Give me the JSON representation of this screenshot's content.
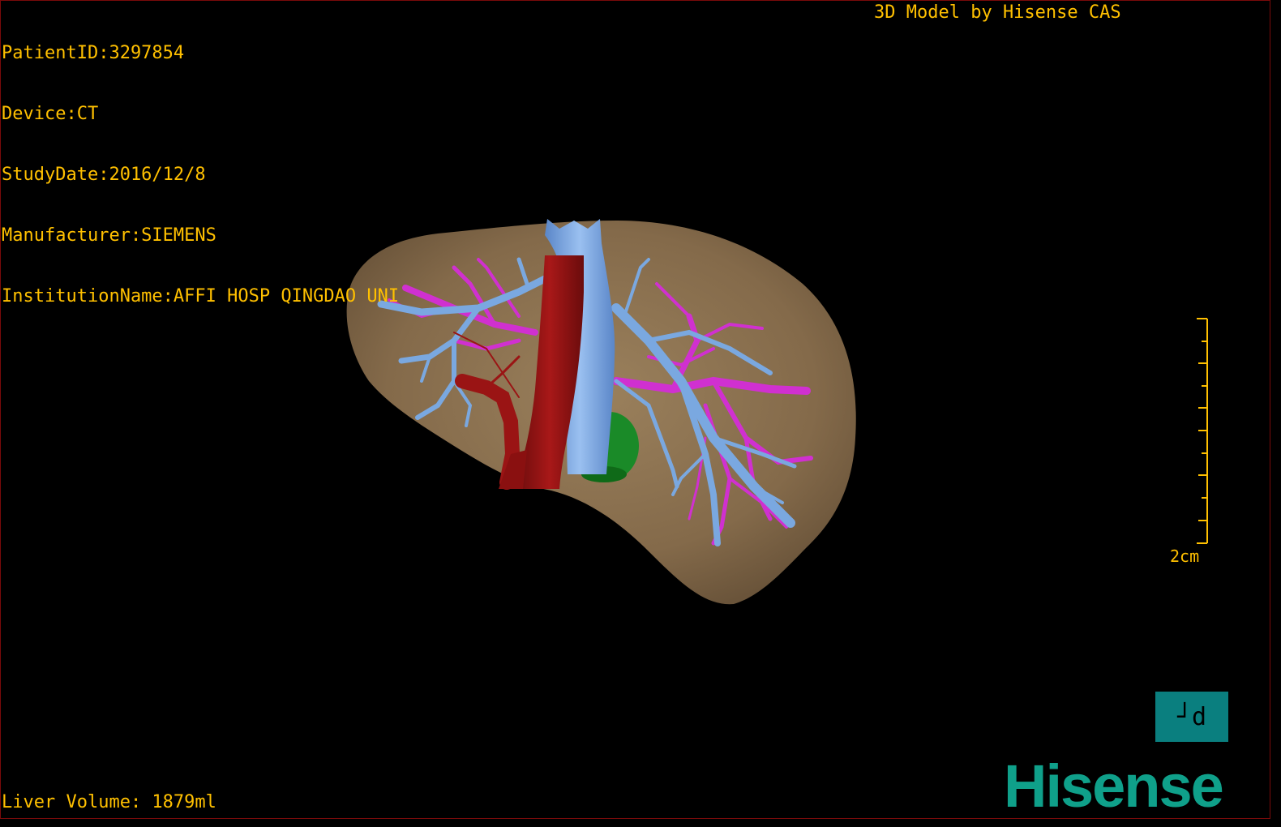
{
  "overlay": {
    "patient_id": "PatientID:3297854",
    "device": "Device:CT",
    "study_date": "StudyDate:2016/12/8",
    "manufacturer": "Manufacturer:SIEMENS",
    "institution": "InstitutionName:AFFI HOSP QINGDAO UNI",
    "brand_credit": "3D Model by Hisense CAS",
    "liver_volume": "Liver Volume: 1879ml",
    "scale_label": "2cm"
  },
  "orientation_button": {
    "label": "┘d"
  },
  "logo": {
    "text": "Hisense"
  },
  "colors": {
    "text": "#ffc000",
    "liver": "#8a7050",
    "hepatic_veins": "#7aa8e0",
    "portal_vein": "#d030d0",
    "artery": "#9a1414",
    "tumor": "#1a8a28",
    "logo": "#0fa08a",
    "orientation_button_bg": "#0a7f7f"
  },
  "model_structures": [
    "liver",
    "hepatic-veins",
    "portal-vein",
    "inferior-vena-cava",
    "aorta",
    "hepatic-artery",
    "gallbladder"
  ]
}
